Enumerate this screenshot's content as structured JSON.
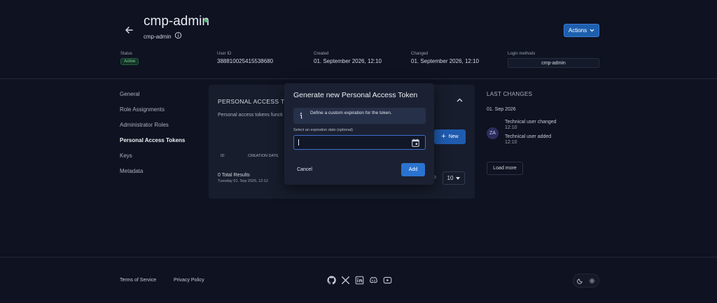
{
  "header": {
    "title": "cmp-admin",
    "subtitle": "cmp-admin",
    "actions_label": "Actions",
    "meta": [
      {
        "label": "Status",
        "value": "Active"
      },
      {
        "label": "User ID",
        "value": "388810025415538680"
      },
      {
        "label": "Created",
        "value": "01. September 2026, 12:10"
      },
      {
        "label": "Changed",
        "value": "01. September 2026, 12:10"
      },
      {
        "label": "Login methods",
        "value": "cmp-admin"
      }
    ]
  },
  "sidebar": {
    "items": [
      {
        "label": "General"
      },
      {
        "label": "Role Assignments"
      },
      {
        "label": "Administrator Roles"
      },
      {
        "label": "Personal Access Tokens"
      },
      {
        "label": "Keys"
      },
      {
        "label": "Metadata"
      }
    ]
  },
  "card": {
    "title": "PERSONAL ACCESS TO",
    "description": "Personal access tokens functi",
    "new_label": "New",
    "columns": [
      "ID",
      "CREATION DATE"
    ],
    "total": "0 Total Results",
    "timestamp": "Tuesday 01. Sep 2026, 12:12",
    "page_size": "10",
    "page_prefix": "o"
  },
  "changes": {
    "title": "LAST CHANGES",
    "date": "01. Sep 2026",
    "avatar": "ZA",
    "entries": [
      {
        "text": "Technical user changed",
        "time": "12:10"
      },
      {
        "text": "Technical user added",
        "time": "12:10"
      }
    ],
    "load_more": "Load more"
  },
  "modal": {
    "title": "Generate new Personal Access Token",
    "hint": "Define a custom expiration for the token.",
    "field_label": "Select an expiration date (optional)",
    "date_value": "",
    "cancel_label": "Cancel",
    "add_label": "Add"
  },
  "footer": {
    "terms": "Terms of Service",
    "privacy": "Privacy Policy",
    "socials": [
      "github-icon",
      "x-icon",
      "linkedin-icon",
      "discord-icon",
      "youtube-icon"
    ]
  },
  "colors": {
    "accent": "#2b73d0",
    "background": "#0e1221",
    "active_status": "#4fbf7a"
  }
}
